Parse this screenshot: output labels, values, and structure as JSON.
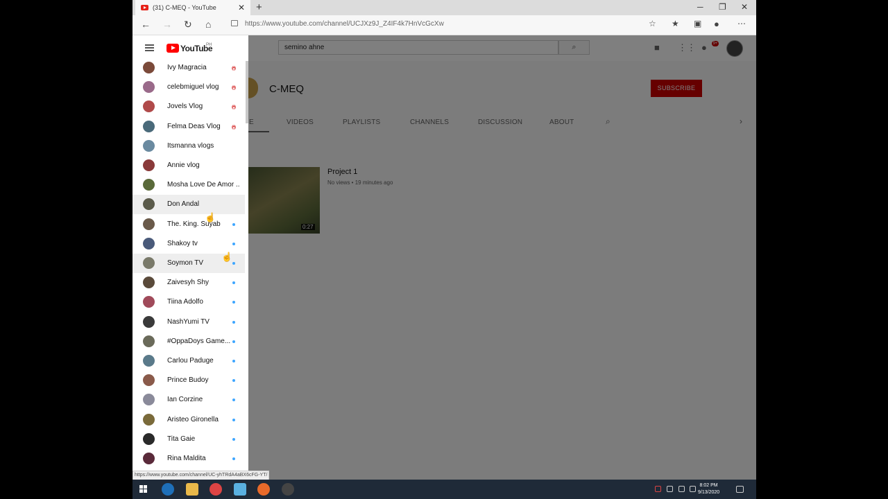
{
  "browser": {
    "tab_title": "(31) C-MEQ - YouTube",
    "tab_close": "✕",
    "new_tab": "+",
    "url": "https://www.youtube.com/channel/UCJXz9J_Z4IF4k7HnVcGcXw",
    "window_controls": [
      "─",
      "❐",
      "✕"
    ]
  },
  "youtube": {
    "logo_text": "YouTube",
    "logo_sup": "PH",
    "search_value": "semino ahne",
    "notification_count": "9+"
  },
  "channel": {
    "name": "C-MEQ",
    "subscribe_label": "SUBSCRIBE",
    "tabs": [
      "E",
      "VIDEOS",
      "PLAYLISTS",
      "CHANNELS",
      "DISCUSSION",
      "ABOUT"
    ]
  },
  "video": {
    "title": "Project 1",
    "meta": "No views • 19 minutes ago",
    "duration": "0:27"
  },
  "subscriptions": [
    {
      "name": "Ivy Magracia",
      "badge": "live",
      "color": "#7b4a3a"
    },
    {
      "name": "celebmiguel vlog",
      "badge": "live",
      "color": "#9a6a8a"
    },
    {
      "name": "Jovels Vlog",
      "badge": "live",
      "color": "#b04a4a"
    },
    {
      "name": "Felma Deas Vlog",
      "badge": "live",
      "color": "#4a6a7a"
    },
    {
      "name": "Itsmanna vlogs",
      "badge": "none",
      "color": "#6a8aa0"
    },
    {
      "name": "Annie vlog",
      "badge": "none",
      "color": "#8a3a3a"
    },
    {
      "name": "Mosha Love De Amor ...",
      "badge": "none",
      "color": "#5a6a3a"
    },
    {
      "name": "Don Andal",
      "badge": "none",
      "color": "#5a5a4a"
    },
    {
      "name": "The. King. Suyab",
      "badge": "new",
      "color": "#6a5a4a"
    },
    {
      "name": "Shakoy tv",
      "badge": "new",
      "color": "#4a5a7a"
    },
    {
      "name": "Soymon TV",
      "badge": "new",
      "color": "#7a7a6a"
    },
    {
      "name": "Zaivesyh Shy",
      "badge": "new",
      "color": "#5a4a3a"
    },
    {
      "name": "Tiina Adolfo",
      "badge": "new",
      "color": "#a04a5a"
    },
    {
      "name": "NashYumi TV",
      "badge": "new",
      "color": "#3a3a3a"
    },
    {
      "name": "#OppaDoys Game...",
      "badge": "new",
      "color": "#6a6a5a"
    },
    {
      "name": "Carlou Paduge",
      "badge": "new",
      "color": "#5a7a8a"
    },
    {
      "name": "Prince Budoy",
      "badge": "new",
      "color": "#8a5a4a"
    },
    {
      "name": "Ian Corzine",
      "badge": "new",
      "color": "#8a8a9a"
    },
    {
      "name": "Aristeo Gironella",
      "badge": "new",
      "color": "#7a6a3a"
    },
    {
      "name": "Tita Gaie",
      "badge": "new",
      "color": "#2a2a2a"
    },
    {
      "name": "Rina Maldita",
      "badge": "new",
      "color": "#5a2a3a"
    }
  ],
  "status_bar_url": "https://www.youtube.com/channel/UC-yhTRdA4aBX6cFG-YT/",
  "taskbar": {
    "time": "8:02 PM",
    "date": "9/13/2020"
  }
}
